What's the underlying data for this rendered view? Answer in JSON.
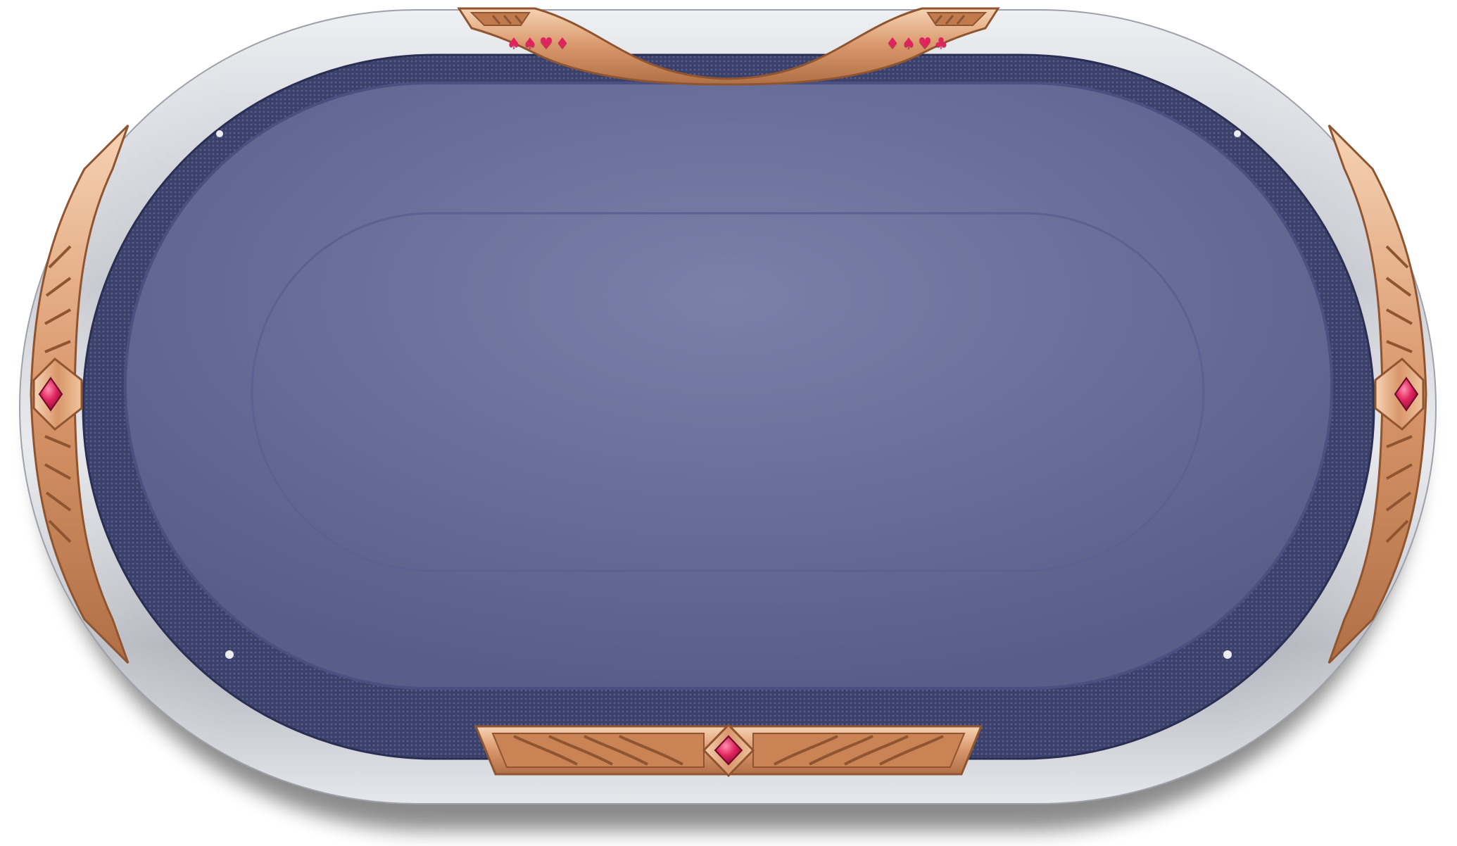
{
  "table": {
    "felt_color": "#6a719b",
    "felt_dark_color": "#3f4470",
    "rail_color": "#c9ccd3",
    "trim_color": "#d9996a",
    "gem_color": "#e0245e"
  },
  "ornaments": {
    "top_left_suits": [
      "♠",
      "♠",
      "♥",
      "♦"
    ],
    "top_right_suits": [
      "♦",
      "♠",
      "♥",
      "♣"
    ],
    "icons": [
      "suit-spade-icon",
      "suit-heart-icon",
      "suit-diamond-icon",
      "suit-club-icon",
      "gem-diamond-icon"
    ]
  }
}
